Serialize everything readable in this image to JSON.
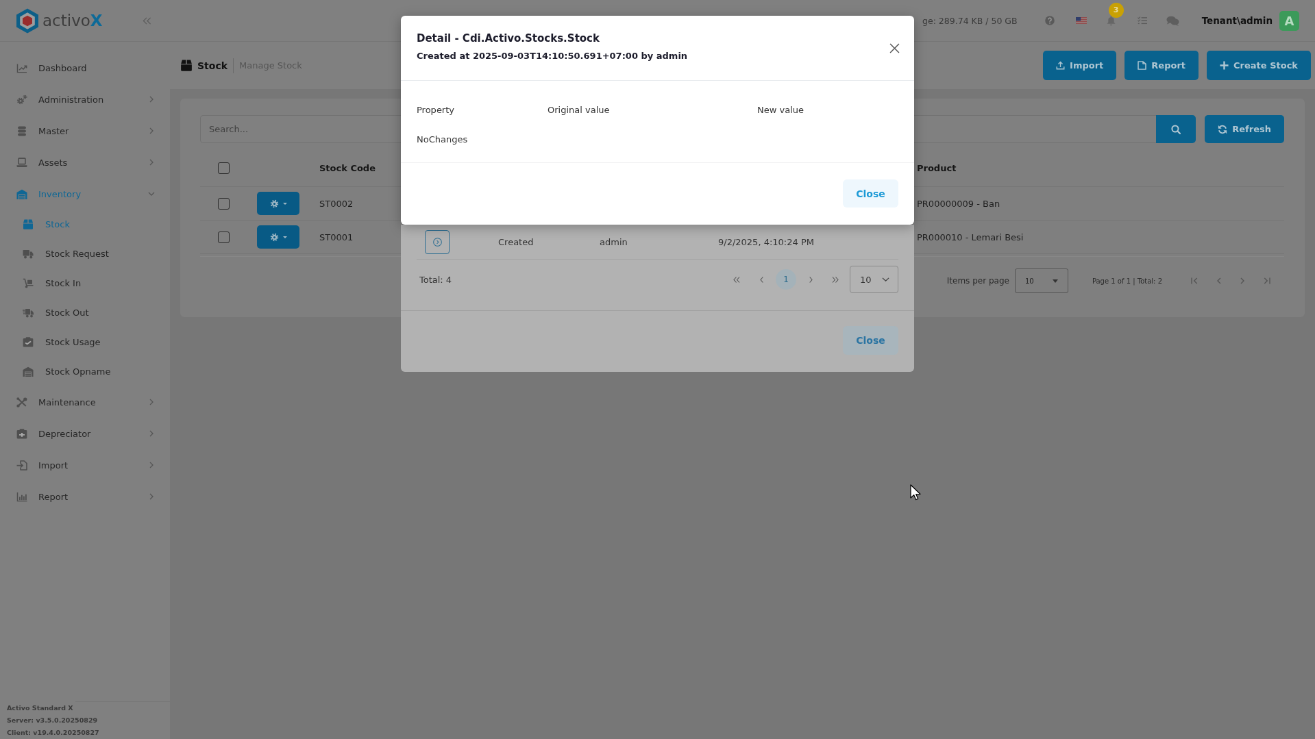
{
  "logo": "activo**X**",
  "header": {
    "storage": "ge: 289.74 KB / 50 GB",
    "notifications": "3",
    "user": "Tenant\\admin",
    "avatar": "A"
  },
  "sidebar": {
    "items": [
      {
        "label": "Dashboard",
        "selected": false
      },
      {
        "label": "Administration",
        "selected": false,
        "expanded": false
      },
      {
        "label": "Master",
        "selected": false,
        "expanded": false
      },
      {
        "label": "Assets",
        "selected": false,
        "expanded": false
      },
      {
        "label": "Inventory",
        "selected": true,
        "expanded": true,
        "children": [
          {
            "label": "Stock",
            "selected": true
          },
          {
            "label": "Stock Request",
            "selected": false
          },
          {
            "label": "Stock In",
            "selected": false
          },
          {
            "label": "Stock Out",
            "selected": false
          },
          {
            "label": "Stock Usage",
            "selected": false
          },
          {
            "label": "Stock Opname",
            "selected": false
          }
        ]
      },
      {
        "label": "Maintenance",
        "selected": false,
        "expanded": false
      },
      {
        "label": "Depreciator",
        "selected": false,
        "expanded": false
      },
      {
        "label": "Import",
        "selected": false,
        "expanded": false
      },
      {
        "label": "Report",
        "selected": false,
        "expanded": false
      }
    ],
    "footer": [
      "Activo Standard X",
      "Server: v3.5.0.20250829",
      "Client: v19.4.0.20250827"
    ]
  },
  "page": {
    "title": "Stock",
    "subtitle": "Manage Stock",
    "actions": [
      "Import",
      "Report",
      "Create Stock"
    ]
  },
  "search": {
    "placeholder": "Search...",
    "refresh": "Refresh"
  },
  "table": {
    "all_checked": false,
    "columns": [
      "Stock Code",
      "Product"
    ],
    "rows": [
      {
        "checked": false,
        "code": "ST0002",
        "product": "PR00000009 - Ban"
      },
      {
        "checked": false,
        "code": "ST0001",
        "product": "PR000010 - Lemari Besi"
      }
    ]
  },
  "pagination": {
    "label": "Items per page",
    "page_size": "10",
    "info": "Page 1 of 1 | Total: 2"
  },
  "history_dialog": {
    "rows": [
      {
        "action": "Created",
        "user": "admin",
        "time": "9/2/2025, 4:10:24 PM"
      }
    ],
    "total": "Total: 4",
    "pages": [
      {
        "label": "1",
        "selected": true
      }
    ],
    "page_size": "10",
    "close": "Close"
  },
  "detail_dialog": {
    "title": "Detail - Cdi.Activo.Stocks.Stock",
    "subtitle": "Created at 2025-09-03T14:10:50.691+07:00 by admin",
    "columns": [
      "Property",
      "Original value",
      "New value"
    ],
    "empty": "NoChanges",
    "close": "Close"
  }
}
